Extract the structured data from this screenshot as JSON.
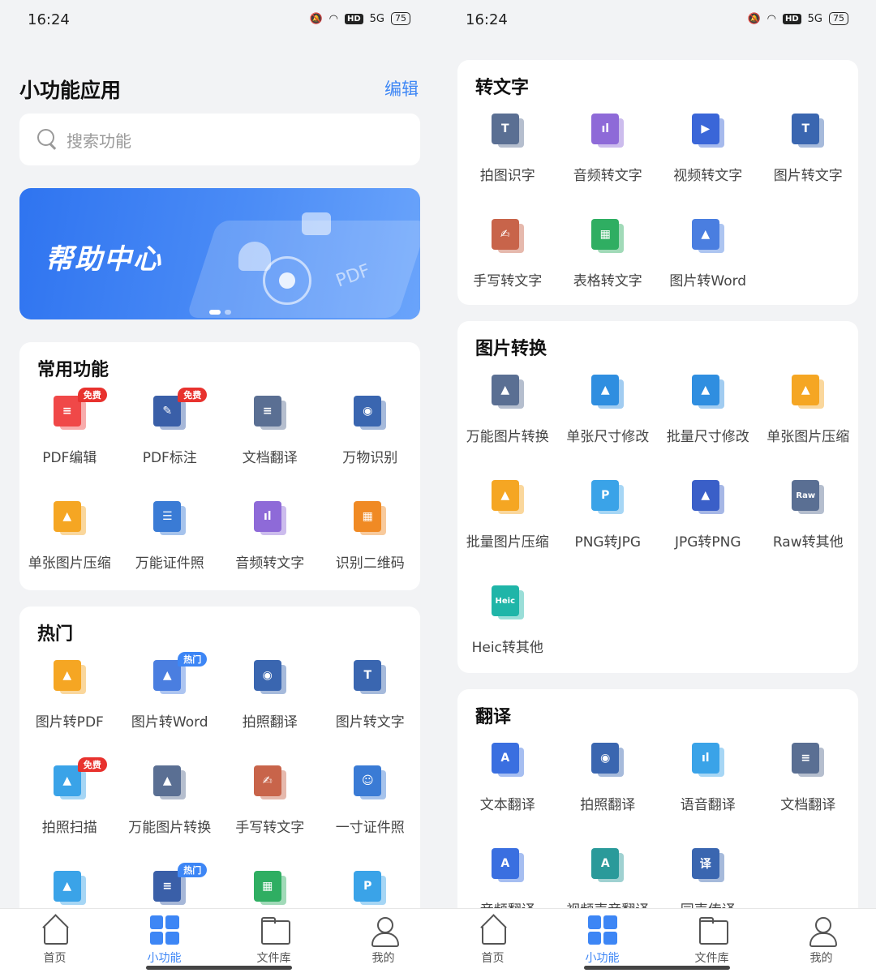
{
  "status": {
    "time": "16:24",
    "hd": "HD",
    "signal": "5G",
    "battery": "75"
  },
  "left": {
    "title": "小功能应用",
    "edit_label": "编辑",
    "search_placeholder": "搜索功能",
    "banner_text": "帮助中心",
    "banner_pdf": "PDF",
    "common": {
      "title": "常用功能",
      "items": [
        {
          "label": "PDF编辑",
          "badge": "免费",
          "icon": "pdf-edit-icon",
          "color": "#f04848",
          "glyph": "≡"
        },
        {
          "label": "PDF标注",
          "badge": "免费",
          "icon": "pdf-annotate-icon",
          "color": "#3a5fa8",
          "glyph": "✎"
        },
        {
          "label": "文档翻译",
          "badge": "",
          "icon": "doc-translate-icon",
          "color": "#5a6f93",
          "glyph": "≡"
        },
        {
          "label": "万物识别",
          "badge": "",
          "icon": "object-recognition-icon",
          "color": "#3a66b0",
          "glyph": "◉"
        },
        {
          "label": "单张图片压缩",
          "badge": "",
          "icon": "image-compress-icon",
          "color": "#f5a623",
          "glyph": "▲"
        },
        {
          "label": "万能证件照",
          "badge": "",
          "icon": "id-photo-icon",
          "color": "#3a7bd5",
          "glyph": "☰"
        },
        {
          "label": "音频转文字",
          "badge": "",
          "icon": "audio-to-text-icon",
          "color": "#8e6ad8",
          "glyph": "ıl"
        },
        {
          "label": "识别二维码",
          "badge": "",
          "icon": "qr-code-icon",
          "color": "#f08a24",
          "glyph": "▦"
        }
      ]
    },
    "hot": {
      "title": "热门",
      "items": [
        {
          "label": "图片转PDF",
          "badge": "",
          "icon": "image-to-pdf-icon",
          "color": "#f5a623",
          "glyph": "▲"
        },
        {
          "label": "图片转Word",
          "badge": "热门",
          "icon": "image-to-word-icon",
          "color": "#4a7ee0",
          "glyph": "▲"
        },
        {
          "label": "拍照翻译",
          "badge": "",
          "icon": "camera-translate-icon",
          "color": "#3a66b0",
          "glyph": "◉"
        },
        {
          "label": "图片转文字",
          "badge": "",
          "icon": "image-to-text-icon",
          "color": "#3a66b0",
          "glyph": "T"
        },
        {
          "label": "拍照扫描",
          "badge": "免费",
          "icon": "photo-scan-icon",
          "color": "#3aa3e8",
          "glyph": "▲"
        },
        {
          "label": "万能图片转换",
          "badge": "",
          "icon": "image-convert-icon",
          "color": "#5a6f93",
          "glyph": "▲"
        },
        {
          "label": "手写转文字",
          "badge": "",
          "icon": "handwriting-icon",
          "color": "#c8644a",
          "glyph": "✍"
        },
        {
          "label": "一寸证件照",
          "badge": "",
          "icon": "one-inch-photo-icon",
          "color": "#3a7bd5",
          "glyph": "☺"
        },
        {
          "label": "",
          "badge": "",
          "icon": "image-repair-icon",
          "color": "#3aa3e8",
          "glyph": "▲"
        },
        {
          "label": "",
          "badge": "热门",
          "icon": "doc-tool-icon",
          "color": "#3a5fa8",
          "glyph": "≡"
        },
        {
          "label": "",
          "badge": "",
          "icon": "table-tool-icon",
          "color": "#2fae62",
          "glyph": "▦"
        },
        {
          "label": "",
          "badge": "",
          "icon": "png-tool-icon",
          "color": "#3aa3e8",
          "glyph": "P"
        }
      ]
    }
  },
  "right": {
    "to_text": {
      "title": "转文字",
      "items": [
        {
          "label": "拍图识字",
          "icon": "photo-ocr-icon",
          "color": "#5a6f93",
          "glyph": "T"
        },
        {
          "label": "音频转文字",
          "icon": "audio-to-text-icon",
          "color": "#8e6ad8",
          "glyph": "ıl"
        },
        {
          "label": "视频转文字",
          "icon": "video-to-text-icon",
          "color": "#3a66d8",
          "glyph": "▶"
        },
        {
          "label": "图片转文字",
          "icon": "image-to-text-icon",
          "color": "#3a66b0",
          "glyph": "T"
        },
        {
          "label": "手写转文字",
          "icon": "handwriting-icon",
          "color": "#c8644a",
          "glyph": "✍"
        },
        {
          "label": "表格转文字",
          "icon": "table-to-text-icon",
          "color": "#2fae62",
          "glyph": "▦"
        },
        {
          "label": "图片转Word",
          "icon": "image-to-word-icon",
          "color": "#4a7ee0",
          "glyph": "▲"
        }
      ]
    },
    "image_convert": {
      "title": "图片转换",
      "items": [
        {
          "label": "万能图片转换",
          "icon": "image-convert-icon",
          "color": "#5a6f93",
          "glyph": "▲"
        },
        {
          "label": "单张尺寸修改",
          "icon": "resize-single-icon",
          "color": "#2f8ee0",
          "glyph": "▲"
        },
        {
          "label": "批量尺寸修改",
          "icon": "resize-batch-icon",
          "color": "#2f8ee0",
          "glyph": "▲"
        },
        {
          "label": "单张图片压缩",
          "icon": "image-compress-icon",
          "color": "#f5a623",
          "glyph": "▲"
        },
        {
          "label": "批量图片压缩",
          "icon": "batch-compress-icon",
          "color": "#f5a623",
          "glyph": "▲"
        },
        {
          "label": "PNG转JPG",
          "icon": "png-to-jpg-icon",
          "color": "#3aa3e8",
          "glyph": "P"
        },
        {
          "label": "JPG转PNG",
          "icon": "jpg-to-png-icon",
          "color": "#3a5fc8",
          "glyph": "▲"
        },
        {
          "label": "Raw转其他",
          "icon": "raw-convert-icon",
          "color": "#5a6f93",
          "glyph": "Raw"
        },
        {
          "label": "Heic转其他",
          "icon": "heic-convert-icon",
          "color": "#1fb5a8",
          "glyph": "Heic"
        }
      ]
    },
    "translate": {
      "title": "翻译",
      "items": [
        {
          "label": "文本翻译",
          "icon": "text-translate-icon",
          "color": "#3a6fe0",
          "glyph": "A"
        },
        {
          "label": "拍照翻译",
          "icon": "camera-translate-icon",
          "color": "#3a66b0",
          "glyph": "◉"
        },
        {
          "label": "语音翻译",
          "icon": "voice-translate-icon",
          "color": "#3aa3e8",
          "glyph": "ıl"
        },
        {
          "label": "文档翻译",
          "icon": "doc-translate-icon",
          "color": "#5a6f93",
          "glyph": "≡"
        },
        {
          "label": "音频翻译",
          "icon": "audio-translate-icon",
          "color": "#3a6fe0",
          "glyph": "A"
        },
        {
          "label": "视频声音翻译",
          "icon": "video-voice-translate-icon",
          "color": "#2a9a9a",
          "glyph": "A"
        },
        {
          "label": "同声传译",
          "icon": "simultaneous-interp-icon",
          "color": "#3a66b0",
          "glyph": "译"
        }
      ]
    }
  },
  "tabs": [
    {
      "label": "首页",
      "icon": "home-icon"
    },
    {
      "label": "小功能",
      "icon": "grid-icon"
    },
    {
      "label": "文件库",
      "icon": "folder-icon"
    },
    {
      "label": "我的",
      "icon": "user-icon"
    }
  ],
  "colors": {
    "accent": "#3d86f5",
    "free_badge": "#e8322e",
    "hot_badge": "#3d86f5"
  }
}
